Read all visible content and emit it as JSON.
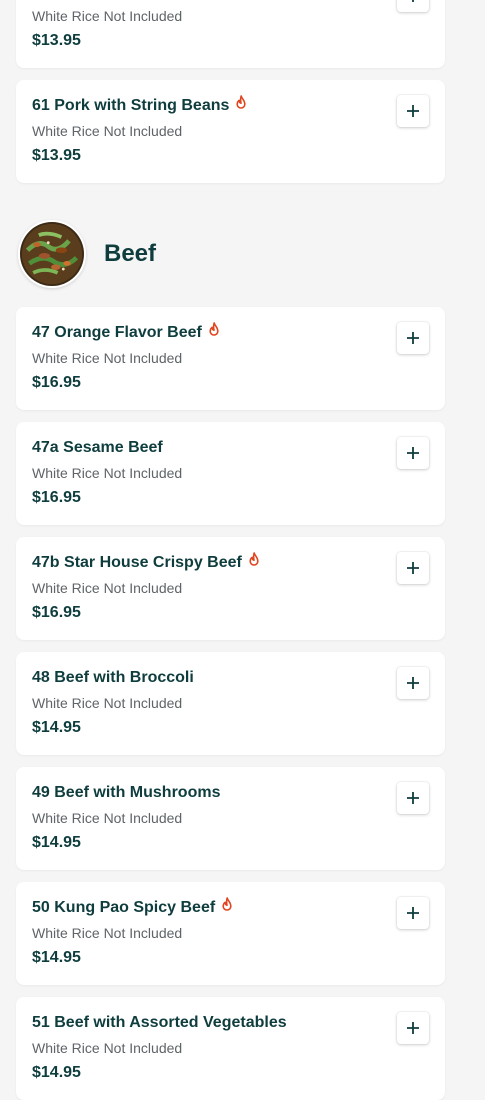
{
  "accent_color": "#0f3d3e",
  "spicy_color": "#e0451f",
  "section": {
    "title": "Beef",
    "image_icon": "beef-dish-photo"
  },
  "items_before": [
    {
      "name": "",
      "description": "White Rice Not Included",
      "price": "$13.95",
      "spicy": false
    },
    {
      "name": "61 Pork with String Beans",
      "description": "White Rice Not Included",
      "price": "$13.95",
      "spicy": true
    }
  ],
  "items": [
    {
      "name": "47 Orange Flavor Beef",
      "description": "White Rice Not Included",
      "price": "$16.95",
      "spicy": true
    },
    {
      "name": "47a Sesame Beef",
      "description": "White Rice Not Included",
      "price": "$16.95",
      "spicy": false
    },
    {
      "name": "47b Star House Crispy Beef",
      "description": "White Rice Not Included",
      "price": "$16.95",
      "spicy": true
    },
    {
      "name": "48 Beef with Broccoli",
      "description": "White Rice Not Included",
      "price": "$14.95",
      "spicy": false
    },
    {
      "name": "49 Beef with Mushrooms",
      "description": "White Rice Not Included",
      "price": "$14.95",
      "spicy": false
    },
    {
      "name": "50 Kung Pao Spicy Beef",
      "description": "White Rice Not Included",
      "price": "$14.95",
      "spicy": true
    },
    {
      "name": "51 Beef with Assorted Vegetables",
      "description": "White Rice Not Included",
      "price": "$14.95",
      "spicy": false
    }
  ]
}
